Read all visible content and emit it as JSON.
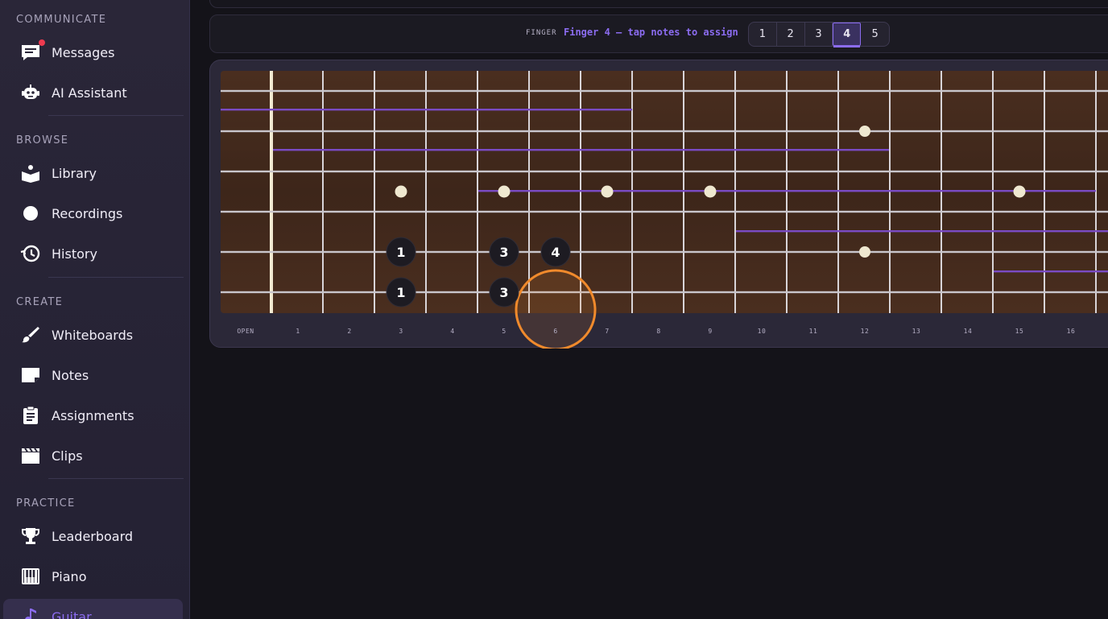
{
  "sidebar": {
    "sections": [
      {
        "label": "COMMUNICATE",
        "items": [
          {
            "label": "Messages",
            "icon": "message-icon",
            "has_badge": true
          },
          {
            "label": "AI Assistant",
            "icon": "robot-icon"
          }
        ]
      },
      {
        "label": "BROWSE",
        "items": [
          {
            "label": "Library",
            "icon": "book-icon"
          },
          {
            "label": "Recordings",
            "icon": "record-icon"
          },
          {
            "label": "History",
            "icon": "history-icon"
          }
        ]
      },
      {
        "label": "CREATE",
        "items": [
          {
            "label": "Whiteboards",
            "icon": "brush-icon"
          },
          {
            "label": "Notes",
            "icon": "note-icon"
          },
          {
            "label": "Assignments",
            "icon": "clipboard-icon"
          },
          {
            "label": "Clips",
            "icon": "clapper-icon"
          }
        ]
      },
      {
        "label": "PRACTICE",
        "items": [
          {
            "label": "Leaderboard",
            "icon": "trophy-icon"
          },
          {
            "label": "Piano",
            "icon": "piano-icon"
          },
          {
            "label": "Guitar",
            "icon": "music-note-icon",
            "active": true
          }
        ]
      }
    ]
  },
  "finger_bar": {
    "tag": "FINGER",
    "hint": "Finger 4 — tap notes to assign",
    "buttons": [
      "1",
      "2",
      "3",
      "4",
      "5"
    ],
    "selected": "4"
  },
  "fretboard": {
    "fret_labels": [
      "OPEN",
      "1",
      "2",
      "3",
      "4",
      "5",
      "6",
      "7",
      "8",
      "9",
      "10",
      "11",
      "12",
      "13",
      "14",
      "15",
      "16"
    ],
    "inlay_frets": [
      3,
      5,
      7,
      9,
      12,
      15
    ],
    "double_inlay_fret": 12,
    "finger_notes": [
      {
        "string": 5,
        "fret": 3,
        "finger": "1"
      },
      {
        "string": 5,
        "fret": 5,
        "finger": "3"
      },
      {
        "string": 5,
        "fret": 6,
        "finger": "4"
      },
      {
        "string": 6,
        "fret": 3,
        "finger": "1"
      },
      {
        "string": 6,
        "fret": 5,
        "finger": "3"
      }
    ],
    "highlight": {
      "string": 6,
      "fret": 6
    },
    "colors": {
      "wood": "#3b2519",
      "string": "#c9c6cc",
      "fret": "#d8d4d8",
      "nut": "#f2ead2",
      "inlay": "#efe8d0",
      "scale_line": "#7a4bc4",
      "note_bg": "#1d1b22",
      "highlight": "#f08a2c"
    }
  }
}
